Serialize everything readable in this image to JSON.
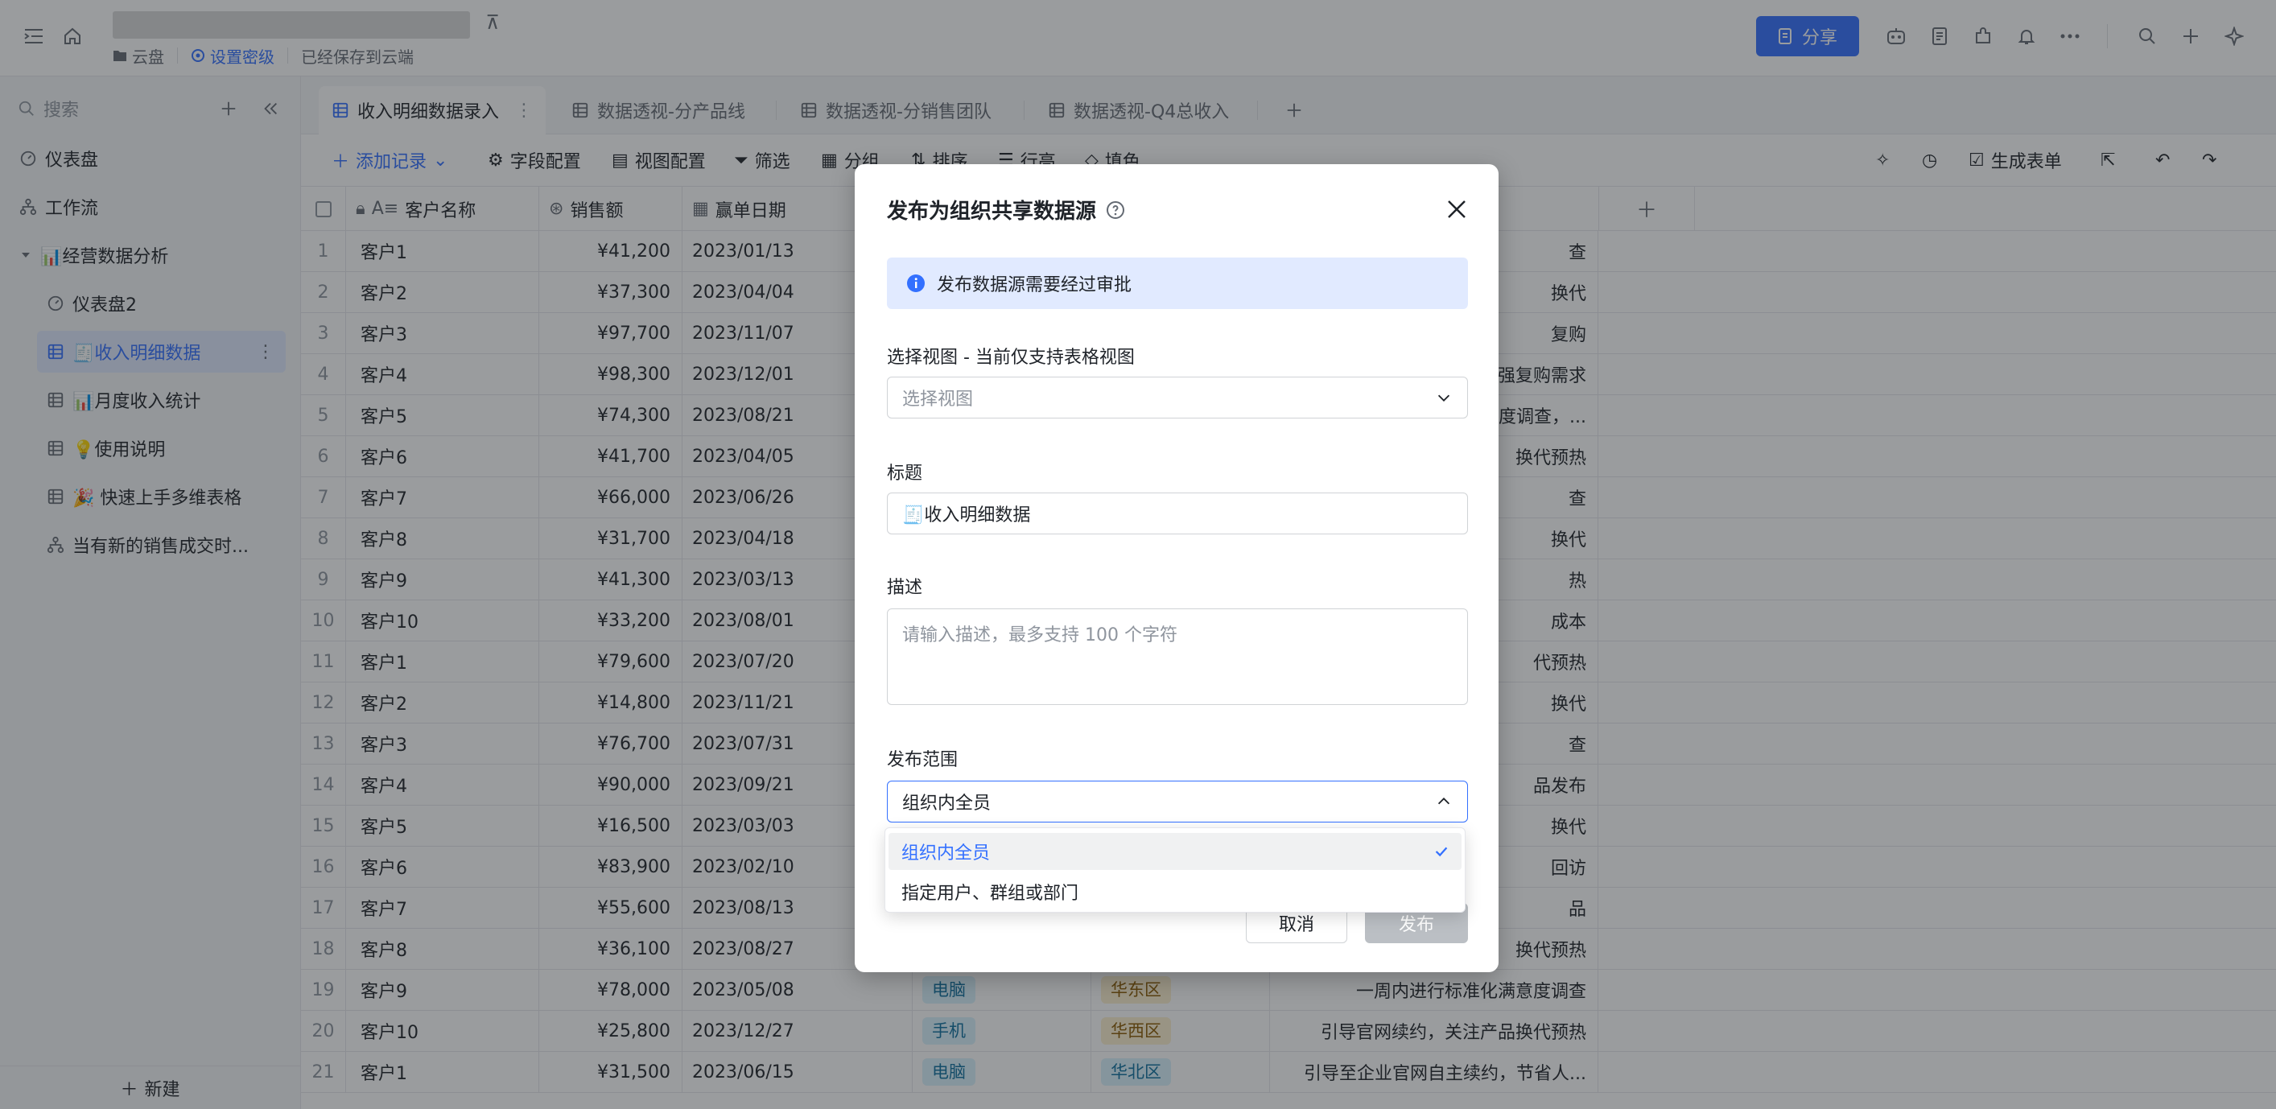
{
  "topbar": {
    "crumb_drive": "云盘",
    "crumb_security": "设置密级",
    "crumb_saved": "已经保存到云端",
    "share_label": "分享",
    "accent_color": "#3370ff"
  },
  "sidebar": {
    "search_placeholder": "搜索",
    "items": [
      {
        "label": "仪表盘"
      },
      {
        "label": "工作流"
      },
      {
        "label": "📊经营数据分析"
      },
      {
        "label": "仪表盘2"
      },
      {
        "label": "🧾收入明细数据"
      },
      {
        "label": "📊月度收入统计"
      },
      {
        "label": "💡使用说明"
      },
      {
        "label": "🎉 快速上手多维表格"
      },
      {
        "label": "当有新的销售成交时..."
      }
    ],
    "new_label": "新建"
  },
  "tabs": [
    {
      "label": "收入明细数据录入"
    },
    {
      "label": "数据透视-分产品线"
    },
    {
      "label": "数据透视-分销售团队"
    },
    {
      "label": "数据透视-Q4总收入"
    }
  ],
  "toolbar": {
    "add_record": "添加记录",
    "field_config": "字段配置",
    "view_config": "视图配置",
    "filter": "筛选",
    "group": "分组",
    "sort": "排序",
    "row_height": "行高",
    "fill_color": "填色",
    "generate_form": "生成表单"
  },
  "grid": {
    "columns": [
      "客户名称",
      "销售额",
      "赢单日期"
    ],
    "rows": [
      {
        "n": "1",
        "customer": "客户1",
        "amount": "¥41,200",
        "date": "2023/01/13",
        "note": "查"
      },
      {
        "n": "2",
        "customer": "客户2",
        "amount": "¥37,300",
        "date": "2023/04/04",
        "note": "换代"
      },
      {
        "n": "3",
        "customer": "客户3",
        "amount": "¥97,700",
        "date": "2023/11/07",
        "note": "复购"
      },
      {
        "n": "4",
        "customer": "客户4",
        "amount": "¥98,300",
        "date": "2023/12/01",
        "note": "强复购需求"
      },
      {
        "n": "5",
        "customer": "客户5",
        "amount": "¥74,300",
        "date": "2023/08/21",
        "note": "度调查，..."
      },
      {
        "n": "6",
        "customer": "客户6",
        "amount": "¥41,700",
        "date": "2023/04/05",
        "note": "换代预热"
      },
      {
        "n": "7",
        "customer": "客户7",
        "amount": "¥66,000",
        "date": "2023/06/26",
        "note": "查"
      },
      {
        "n": "8",
        "customer": "客户8",
        "amount": "¥31,700",
        "date": "2023/04/18",
        "note": "换代"
      },
      {
        "n": "9",
        "customer": "客户9",
        "amount": "¥41,300",
        "date": "2023/03/13",
        "note": "热"
      },
      {
        "n": "10",
        "customer": "客户10",
        "amount": "¥33,200",
        "date": "2023/08/01",
        "note": "成本"
      },
      {
        "n": "11",
        "customer": "客户1",
        "amount": "¥79,600",
        "date": "2023/07/20",
        "note": "代预热"
      },
      {
        "n": "12",
        "customer": "客户2",
        "amount": "¥14,800",
        "date": "2023/11/21",
        "note": "换代"
      },
      {
        "n": "13",
        "customer": "客户3",
        "amount": "¥76,700",
        "date": "2023/07/31",
        "note": "查"
      },
      {
        "n": "14",
        "customer": "客户4",
        "amount": "¥90,000",
        "date": "2023/09/21",
        "note": "品发布"
      },
      {
        "n": "15",
        "customer": "客户5",
        "amount": "¥16,500",
        "date": "2023/03/03",
        "note": "换代"
      },
      {
        "n": "16",
        "customer": "客户6",
        "amount": "¥83,900",
        "date": "2023/02/10",
        "note": "回访"
      },
      {
        "n": "17",
        "customer": "客户7",
        "amount": "¥55,600",
        "date": "2023/08/13",
        "note": "品"
      },
      {
        "n": "18",
        "customer": "客户8",
        "amount": "¥36,100",
        "date": "2023/08/27",
        "note": "换代预热"
      },
      {
        "n": "19",
        "customer": "客户9",
        "amount": "¥78,000",
        "date": "2023/05/08",
        "product": "电脑",
        "region": "华东区",
        "note": "一周内进行标准化满意度调查"
      },
      {
        "n": "20",
        "customer": "客户10",
        "amount": "¥25,800",
        "date": "2023/12/27",
        "product": "手机",
        "region": "华西区",
        "note": "引导官网续约，关注产品换代预热"
      },
      {
        "n": "21",
        "customer": "客户1",
        "amount": "¥31,500",
        "date": "2023/06/15",
        "product": "电脑",
        "region": "华北区",
        "note": "引导至企业官网自主续约，节省人..."
      }
    ]
  },
  "modal": {
    "title": "发布为组织共享数据源",
    "alert": "发布数据源需要经过审批",
    "view_label": "选择视图 - 当前仅支持表格视图",
    "view_placeholder": "选择视图",
    "title_label": "标题",
    "title_value": "🧾收入明细数据",
    "desc_label": "描述",
    "desc_placeholder": "请输入描述，最多支持 100 个字符",
    "scope_label": "发布范围",
    "scope_value": "组织内全员",
    "options": [
      "组织内全员",
      "指定用户、群组或部门"
    ],
    "cancel_label": "取消",
    "publish_label": "发布"
  }
}
